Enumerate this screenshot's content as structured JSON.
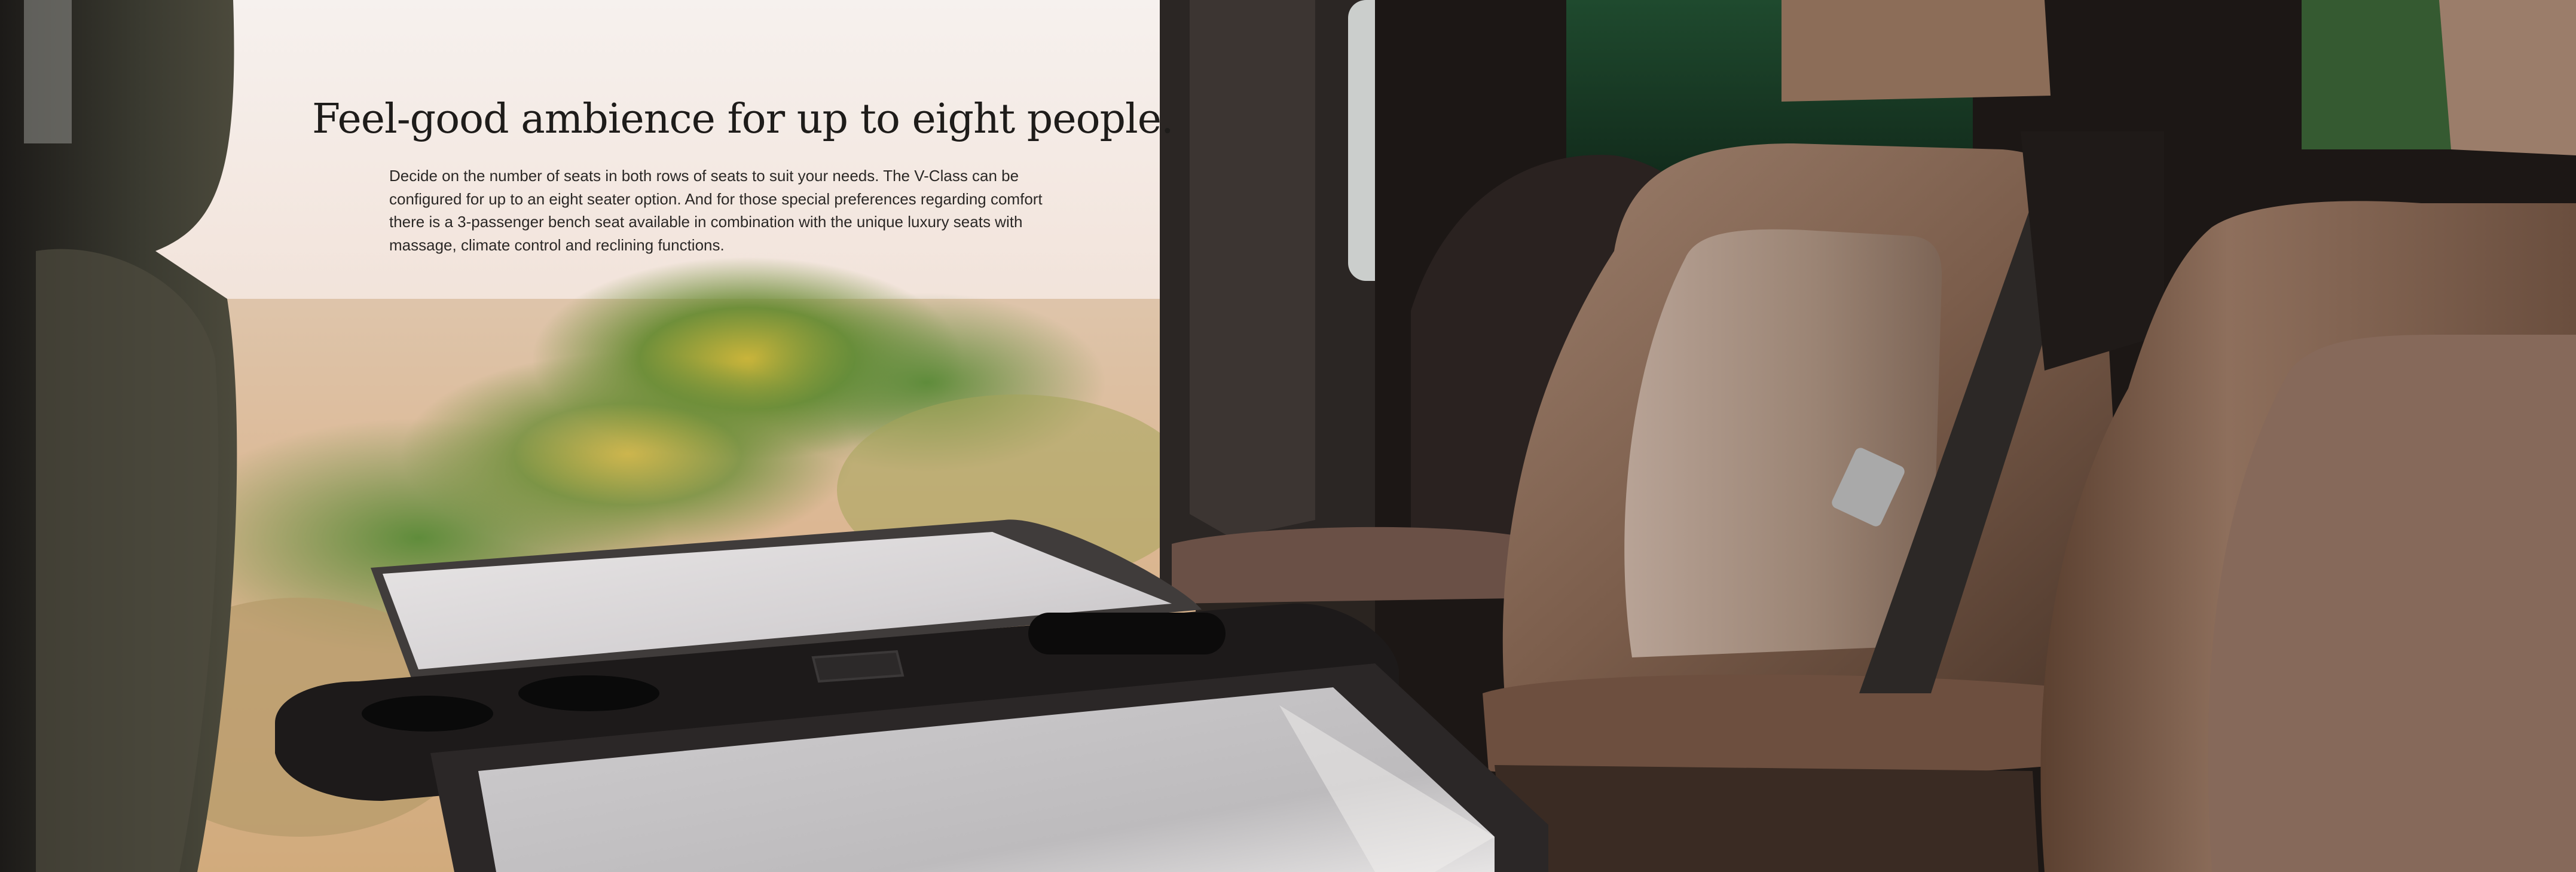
{
  "hero": {
    "headline": "Feel-good ambience for up to eight people.",
    "body": "Decide on the number of seats in both rows of seats to suit your needs. The V-Class can be configured for up to an eight seater option. And for those special preferences regarding comfort there is a 3-passenger bench seat available in combination with the unique luxury seats with massage, climate control and reclining functions."
  }
}
